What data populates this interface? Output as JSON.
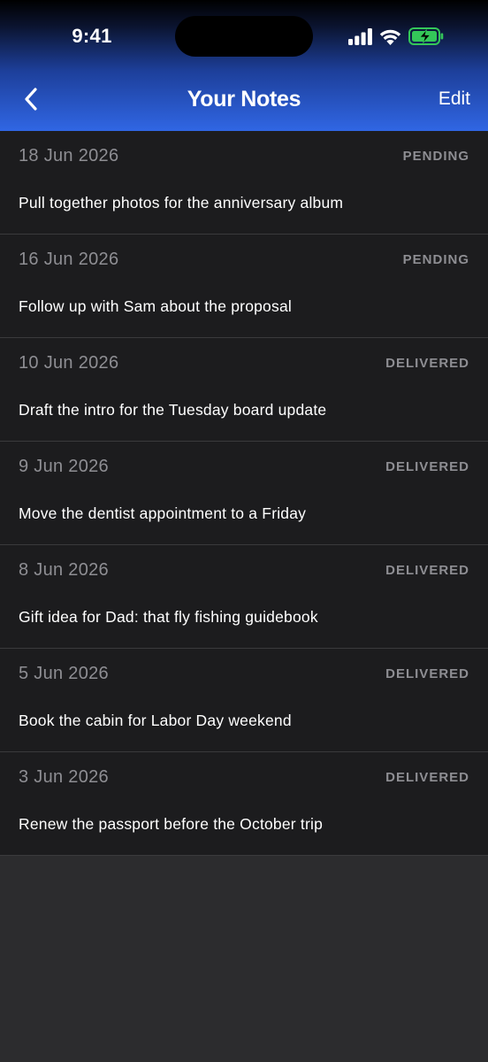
{
  "status_bar": {
    "time": "9:41",
    "icons": [
      "cellular-signal-icon",
      "wifi-icon",
      "battery-charging-icon"
    ],
    "battery_color": "#34c759"
  },
  "nav": {
    "back_icon": "chevron-left-icon",
    "title": "Your Notes",
    "edit_label": "Edit"
  },
  "colors": {
    "gradient_top": "#000000",
    "gradient_bottom": "#3066e4",
    "list_background": "#1c1c1e",
    "page_background": "#2c2c2e",
    "secondary_text": "#8e8e93"
  },
  "notes": [
    {
      "date": "18 Jun 2026",
      "status": "PENDING",
      "text": "Pull together photos for the anniversary album"
    },
    {
      "date": "16 Jun 2026",
      "status": "PENDING",
      "text": "Follow up with Sam about the proposal"
    },
    {
      "date": "10 Jun 2026",
      "status": "DELIVERED",
      "text": "Draft the intro for the Tuesday board update"
    },
    {
      "date": "9 Jun 2026",
      "status": "DELIVERED",
      "text": "Move the dentist appointment to a Friday"
    },
    {
      "date": "8 Jun 2026",
      "status": "DELIVERED",
      "text": "Gift idea for Dad: that fly fishing guidebook"
    },
    {
      "date": "5 Jun 2026",
      "status": "DELIVERED",
      "text": "Book the cabin for Labor Day weekend"
    },
    {
      "date": "3 Jun 2026",
      "status": "DELIVERED",
      "text": "Renew the passport before the October trip"
    }
  ]
}
